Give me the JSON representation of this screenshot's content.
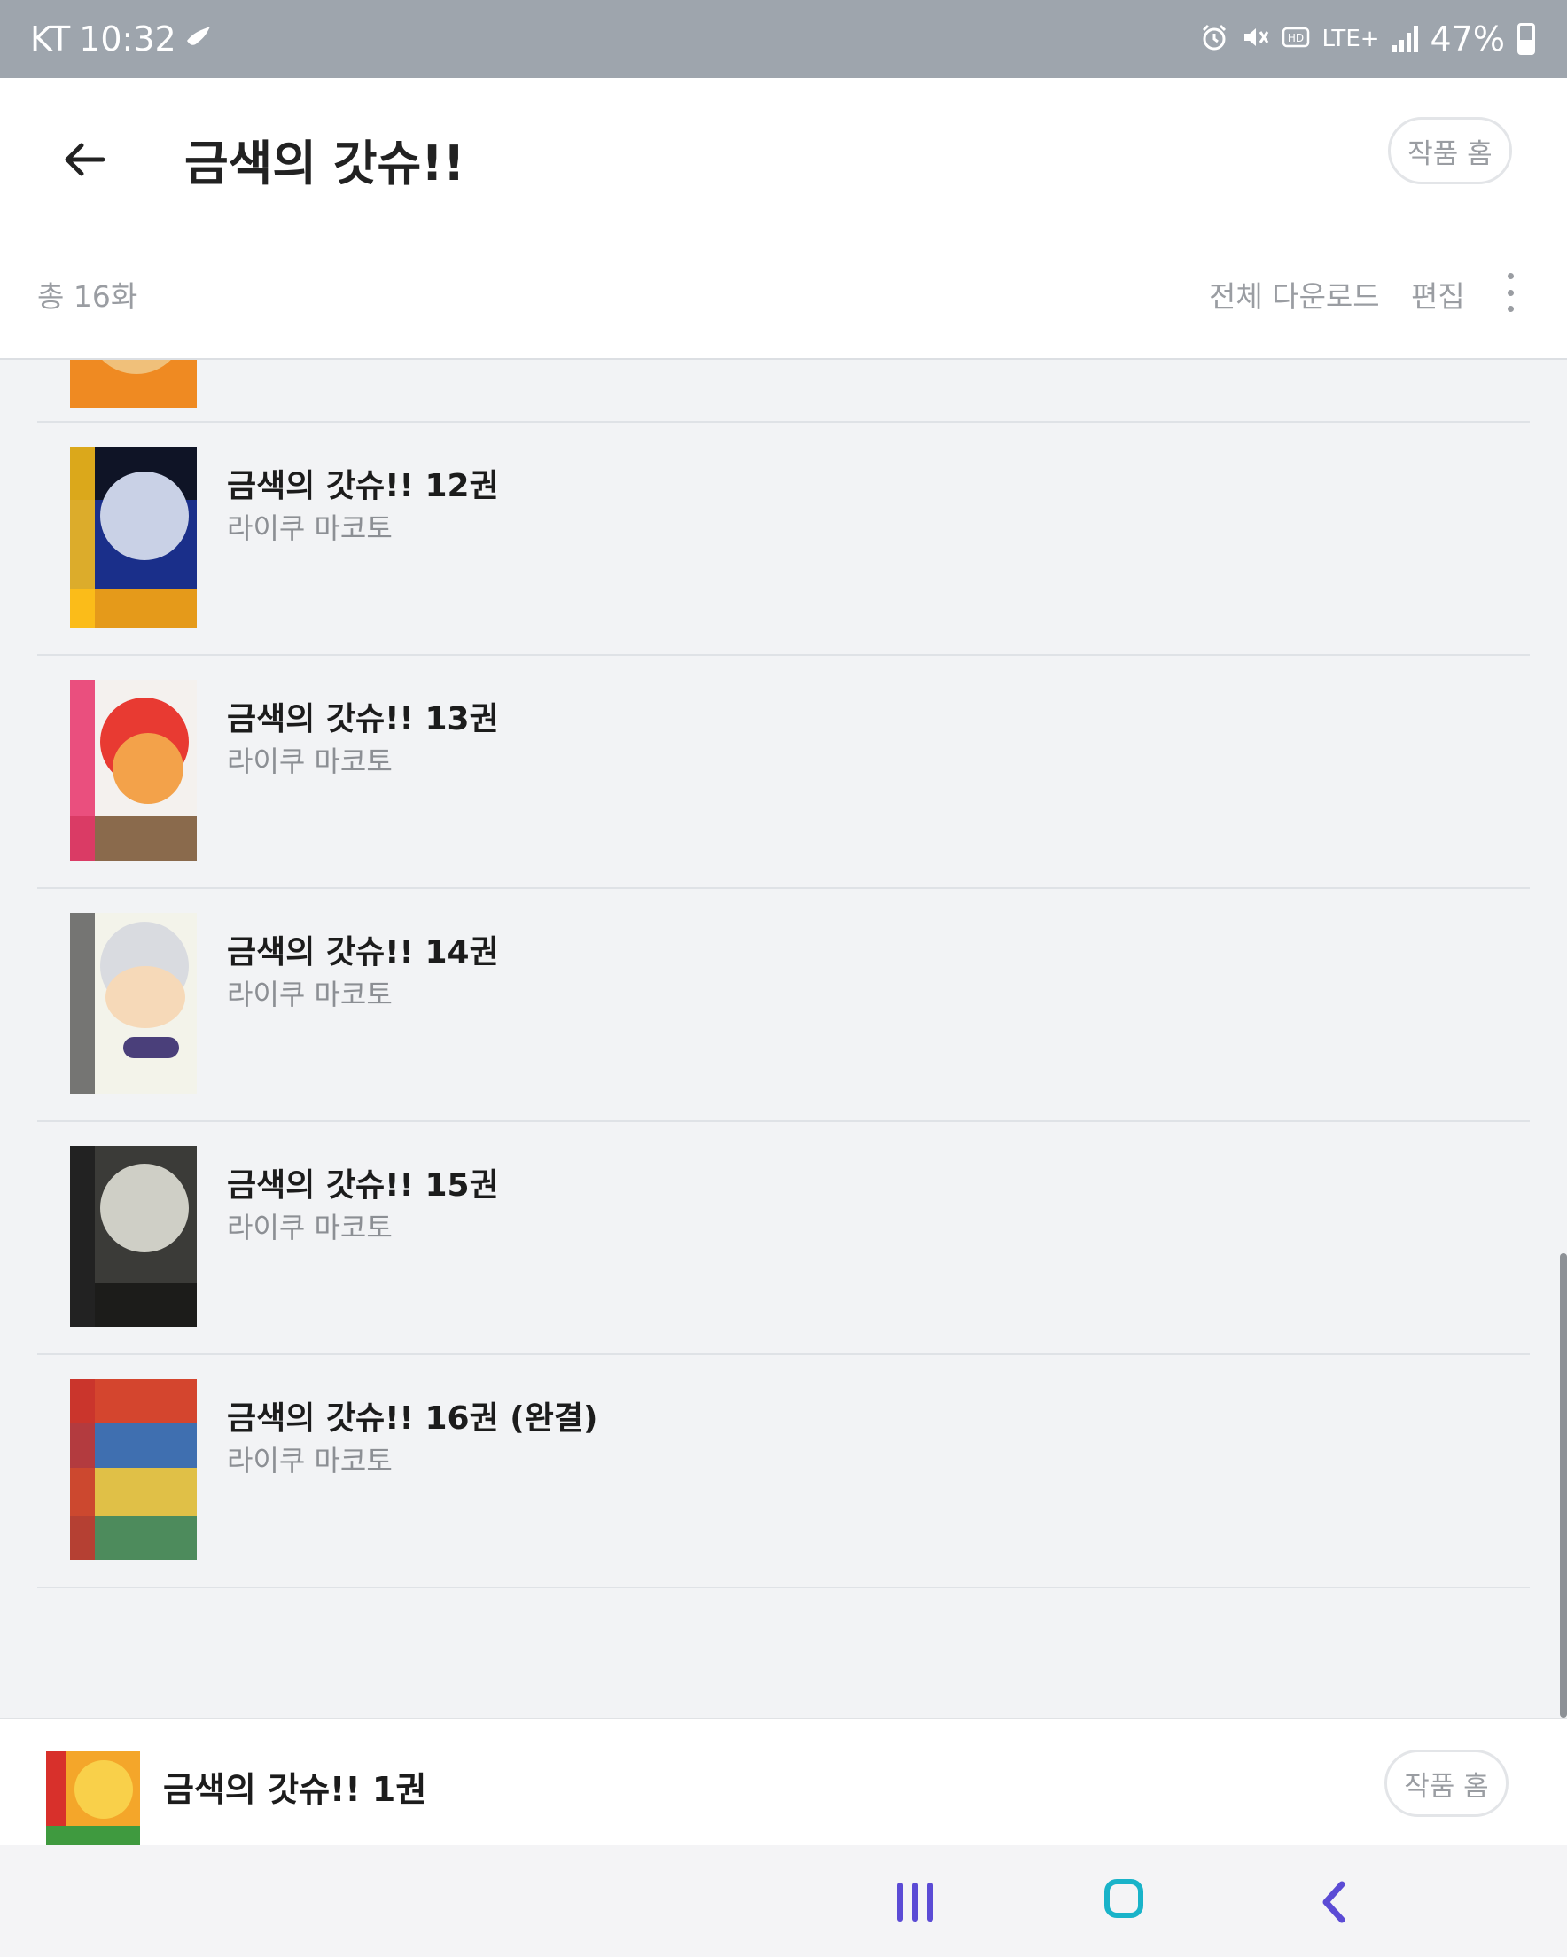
{
  "status_bar": {
    "carrier": "KT",
    "time": "10:32",
    "network": "LTE+",
    "battery": "47%",
    "battery_level": 0.47
  },
  "header": {
    "title": "금색의 갓슈!!",
    "home_button": "작품 홈",
    "total": "총 16화",
    "download_all": "전체 다운로드",
    "edit": "편집"
  },
  "list": {
    "items": [
      {
        "title": "금색의 갓슈!! 12권",
        "author": "라이쿠 마코토"
      },
      {
        "title": "금색의 갓슈!! 13권",
        "author": "라이쿠 마코토"
      },
      {
        "title": "금색의 갓슈!! 14권",
        "author": "라이쿠 마코토"
      },
      {
        "title": "금색의 갓슈!! 15권",
        "author": "라이쿠 마코토"
      },
      {
        "title": "금색의 갓슈!! 16권 (완결)",
        "author": "라이쿠 마코토"
      }
    ]
  },
  "mini_player": {
    "title": "금색의 갓슈!! 1권",
    "home_button": "작품 홈"
  },
  "colors": {
    "status_bar_bg": "#9ea5ad",
    "list_bg": "#f2f3f5",
    "nav_accent": "#5b4bd5",
    "nav_home": "#19b3c9"
  }
}
